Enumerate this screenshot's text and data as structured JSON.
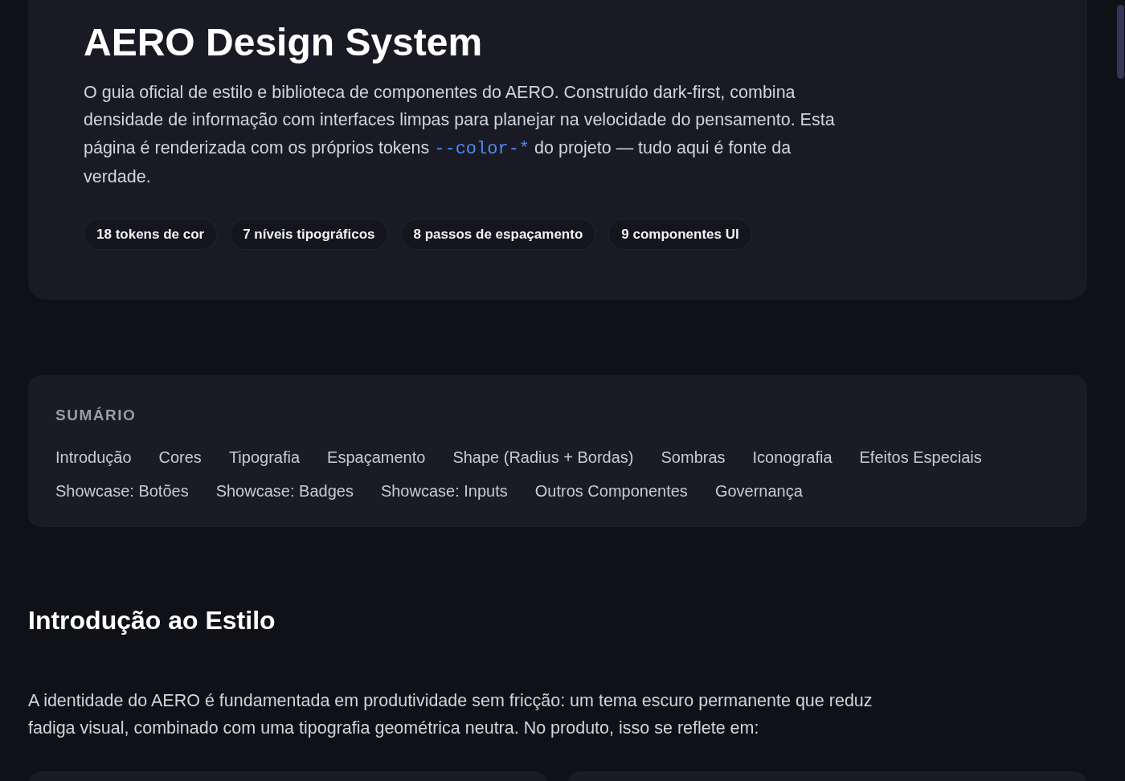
{
  "hero": {
    "title": "AERO Design System",
    "intro": {
      "before": "O guia oficial de estilo e biblioteca de componentes do AERO. Construído dark-first, combina densidade de informação com interfaces limpas para planejar na velocidade do pensamento. Esta página é renderizada com os próprios tokens ",
      "code": "--color-*",
      "after": " do projeto — tudo aqui é fonte da verdade."
    },
    "stats": [
      "18 tokens de cor",
      "7 níveis tipográficos",
      "8 passos de espaçamento",
      "9 componentes UI"
    ]
  },
  "summary": {
    "heading": "SUMÁRIO",
    "links": [
      "Introdução",
      "Cores",
      "Tipografia",
      "Espaçamento",
      "Shape (Radius + Bordas)",
      "Sombras",
      "Iconografia",
      "Efeitos Especiais",
      "Showcase: Botões",
      "Showcase: Badges",
      "Showcase: Inputs",
      "Outros Componentes",
      "Governança"
    ]
  },
  "section": {
    "title": "Introdução ao Estilo",
    "text": "A identidade do AERO é fundamentada em produtividade sem fricção: um tema escuro permanente que reduz fadiga visual, combinado com uma tipografia geométrica neutra. No produto, isso se reflete em:",
    "cards": [
      {
        "kind": "panel"
      },
      {
        "kind": "panel"
      }
    ]
  }
}
